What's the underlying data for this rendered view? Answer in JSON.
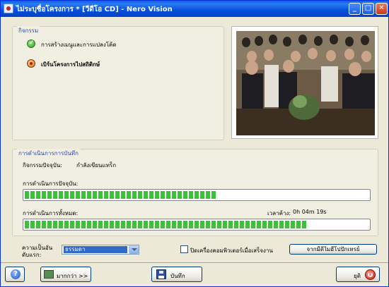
{
  "window": {
    "title": "ไม่ระบุชื่อโครงการ * [วีดีโอ CD] - Nero Vision",
    "minimize_glyph": "_",
    "maximize_glyph": "□",
    "close_glyph": "✕"
  },
  "activity": {
    "group_title": "กิจกรรม",
    "tasks": [
      {
        "label": "การสร้างเมนูและการแปลงโค้ด",
        "status_icon": "check-icon"
      },
      {
        "label": "เบิร์นโครงการไปสถิติกษ์",
        "status_icon": "record-icon"
      }
    ]
  },
  "recording": {
    "group_title": "การดำเนินการการบันทึก",
    "current_activity_label": "กิจกรรมปัจจุบัน:",
    "current_activity_value": "กำลังเขียนแทร็ก",
    "current_progress_label": "การดำเนินการปัจจุบัน:",
    "current_progress_fraction": 0.56,
    "total_progress_label": "การดำเนินการทั้งหมด:",
    "total_progress_fraction": 0.82,
    "time_left_label": "เวลาค้าง:",
    "time_left_value": "0h 04m 19s"
  },
  "options": {
    "priority_label_line1": "ความเป็นอัน",
    "priority_label_line2": "ดับแรก:",
    "priority_value": "ธรรมดา",
    "shutdown_checkbox_label": "ปิดเครื่องคอมพิวเตอร์เมื่อเสร็จงาน",
    "shutdown_checked": false,
    "eject_button_label": "จากมีดิไมฮีโปปักเทรย์"
  },
  "footer": {
    "help_glyph": "?",
    "more_label": "มากกว่า >>",
    "save_label": "บันทึก",
    "stop_label": "ยุติ"
  },
  "colors": {
    "titlebar": "#0A5FE6",
    "group_title": "#2346B8",
    "progress_fill": "#3AC235"
  }
}
